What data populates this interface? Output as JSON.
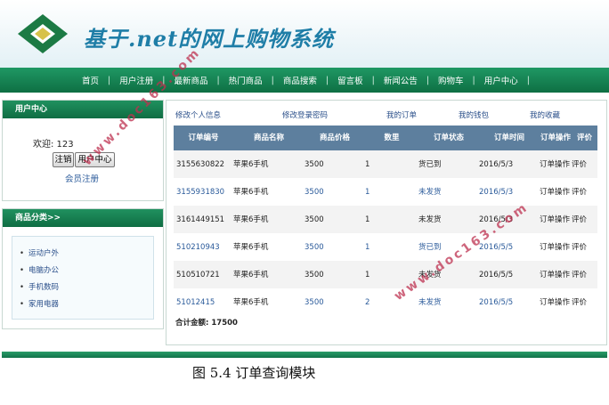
{
  "site": {
    "title": "基于.net的网上购物系统"
  },
  "nav": [
    "首页",
    "用户注册",
    "最新商品",
    "热门商品",
    "商品搜索",
    "留言板",
    "新闻公告",
    "购物车",
    "用户中心"
  ],
  "user_panel": {
    "title": "用户中心",
    "welcome": "欢迎: 123",
    "logout_label": "注销",
    "center_label": "用户中心",
    "register_label": "会员注册"
  },
  "category_panel": {
    "title": "商品分类>>",
    "items": [
      "运动户外",
      "电脑办公",
      "手机数码",
      "家用电器"
    ]
  },
  "sub_links": [
    "修改个人信息",
    "修改登录密码",
    "我的订单",
    "我的钱包",
    "我的收藏"
  ],
  "orders": {
    "columns": [
      "订单编号",
      "商品名称",
      "商品价格",
      "数里",
      "订单状态",
      "订单时间",
      "订单操作",
      "评价"
    ],
    "rows": [
      {
        "id": "3155630822",
        "name": "苹果6手机",
        "price": "3500",
        "qty": "1",
        "status": "货已到",
        "date": "2016/5/3",
        "op": "订单操作",
        "review": "评价"
      },
      {
        "id": "3155931830",
        "name": "苹果6手机",
        "price": "3500",
        "qty": "1",
        "status": "未发货",
        "date": "2016/5/3",
        "op": "订单操作",
        "review": "评价"
      },
      {
        "id": "3161449151",
        "name": "苹果6手机",
        "price": "3500",
        "qty": "1",
        "status": "未发货",
        "date": "2016/5/3",
        "op": "订单操作",
        "review": "评价"
      },
      {
        "id": "510210943",
        "name": "苹果6手机",
        "price": "3500",
        "qty": "1",
        "status": "货已到",
        "date": "2016/5/5",
        "op": "订单操作",
        "review": "评价"
      },
      {
        "id": "510510721",
        "name": "苹果6手机",
        "price": "3500",
        "qty": "1",
        "status": "未发货",
        "date": "2016/5/5",
        "op": "订单操作",
        "review": "评价"
      },
      {
        "id": "51012415",
        "name": "苹果6手机",
        "price": "3500",
        "qty": "2",
        "status": "未发货",
        "date": "2016/5/5",
        "op": "订单操作",
        "review": "评价"
      }
    ],
    "total_label": "合计金额: ",
    "total_value": "17500"
  },
  "caption": "图  5.4  订单查询模块",
  "watermark": "www.doc163.com",
  "colors": {
    "nav_green": "#147f50",
    "table_header": "#5d7f9e",
    "title_blue": "#1f7ea7",
    "link_blue": "#2a5a9a"
  }
}
